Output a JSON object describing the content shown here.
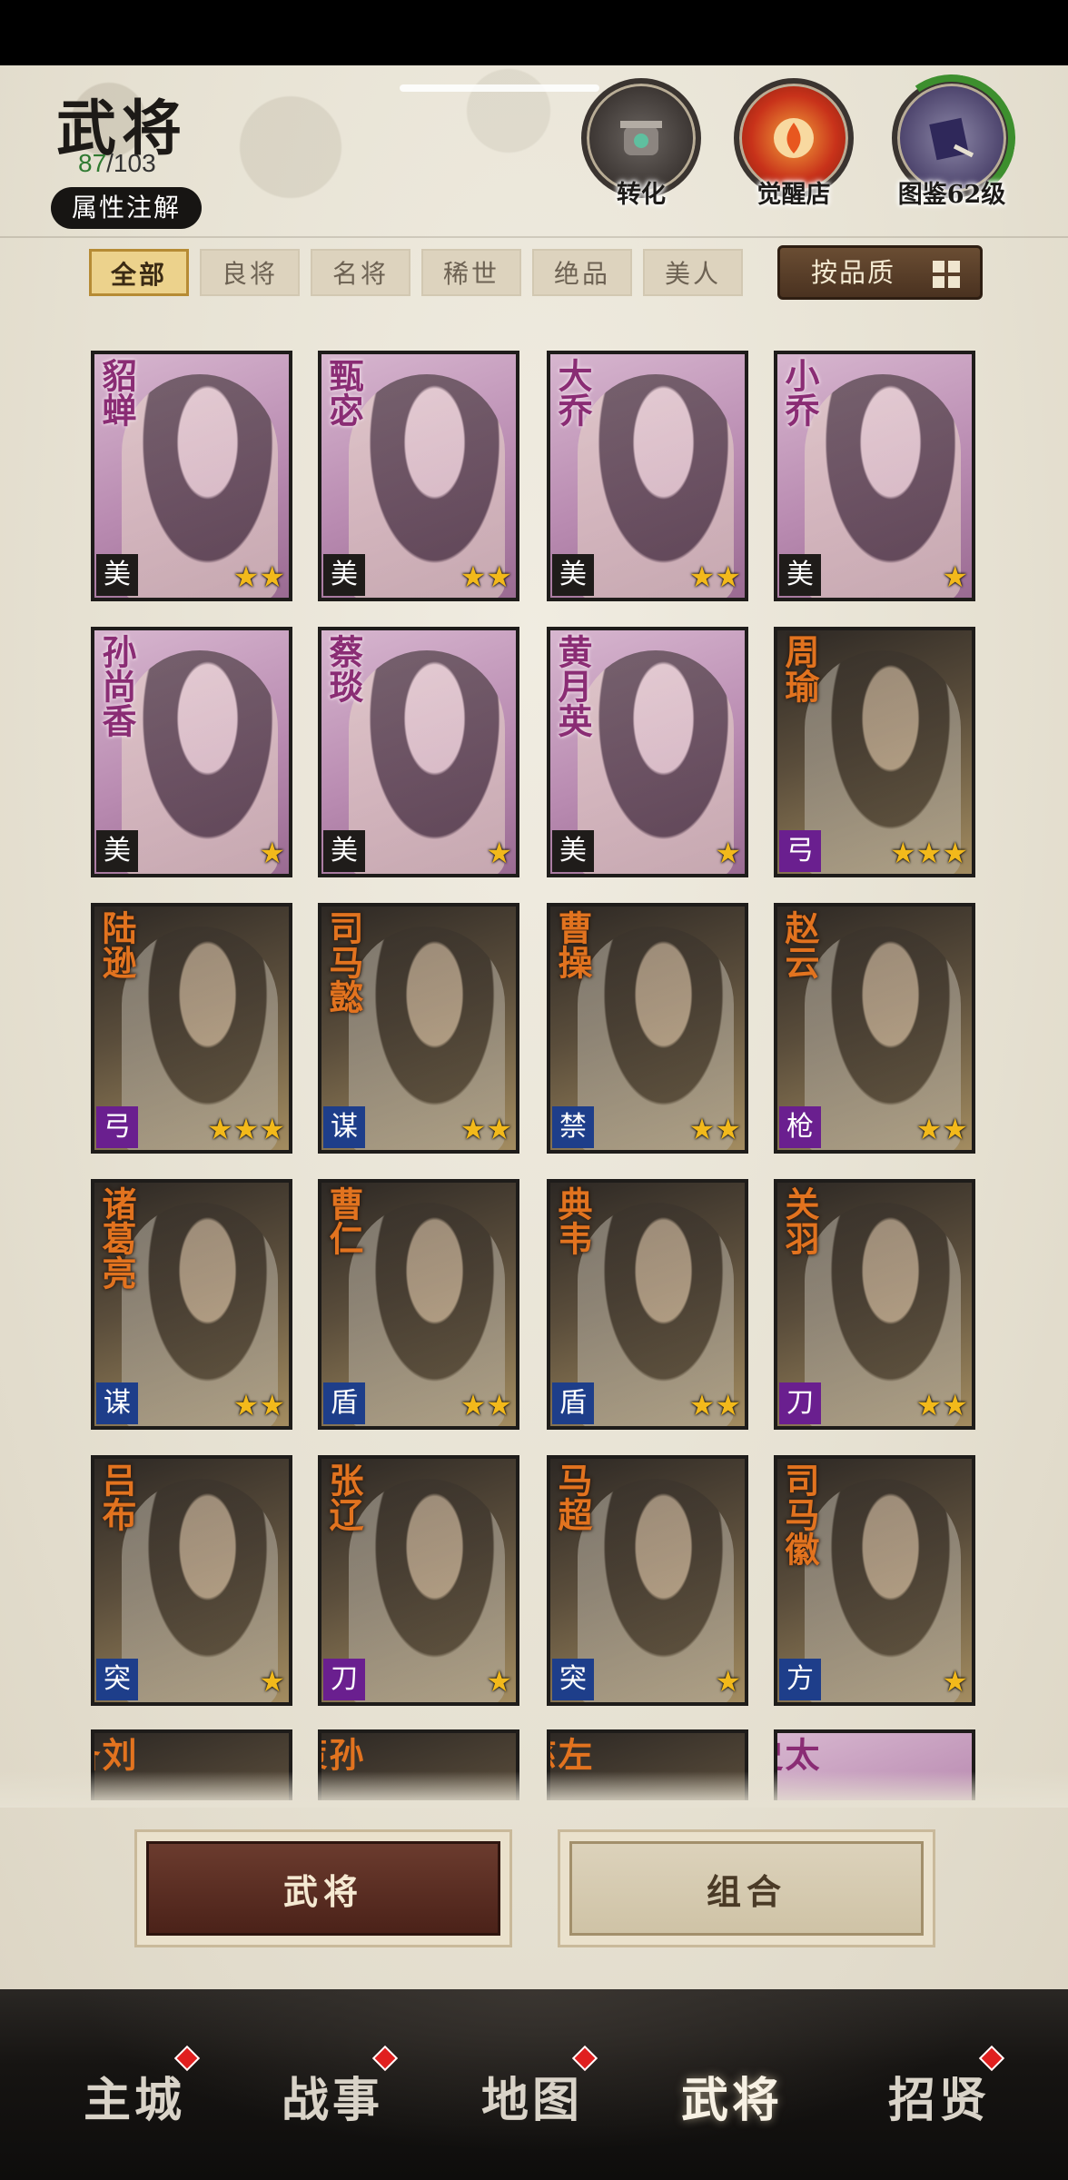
{
  "header": {
    "title": "武将",
    "count_current": "87",
    "count_total": "/103",
    "attr_button": "属性注解"
  },
  "top_icons": [
    {
      "label": "转化",
      "icon": "cauldron-icon"
    },
    {
      "label": "觉醒店",
      "icon": "flame-seal-icon"
    },
    {
      "label": "图鉴62级",
      "icon": "scroll-book-icon"
    }
  ],
  "filters": [
    "全部",
    "良将",
    "名将",
    "稀世",
    "绝品",
    "美人"
  ],
  "active_filter": "全部",
  "sort_button": "按品质",
  "type_colors": {
    "美": "#1f1c1a",
    "弓": "#6a1f8f",
    "谋": "#1e3e8a",
    "禁": "#1e3e8a",
    "枪": "#6a1f8f",
    "盾": "#1e3e8a",
    "刀": "#6a1f8f",
    "突": "#1e3e8a",
    "方": "#1e3e8a"
  },
  "cards": [
    {
      "name": "貂蝉",
      "type": "美",
      "stars": "★★",
      "style": "beauty"
    },
    {
      "name": "甄宓",
      "type": "美",
      "stars": "★★",
      "style": "beauty"
    },
    {
      "name": "大乔",
      "type": "美",
      "stars": "★★",
      "style": "beauty"
    },
    {
      "name": "小乔",
      "type": "美",
      "stars": "★",
      "style": "beauty"
    },
    {
      "name": "孙尚香",
      "type": "美",
      "stars": "★",
      "style": "beauty"
    },
    {
      "name": "蔡琰",
      "type": "美",
      "stars": "★",
      "style": "beauty"
    },
    {
      "name": "黄月英",
      "type": "美",
      "stars": "★",
      "style": "beauty"
    },
    {
      "name": "周瑜",
      "type": "弓",
      "stars": "★★★",
      "style": "hero"
    },
    {
      "name": "陆逊",
      "type": "弓",
      "stars": "★★★",
      "style": "hero"
    },
    {
      "name": "司马懿",
      "type": "谋",
      "stars": "★★",
      "style": "hero"
    },
    {
      "name": "曹操",
      "type": "禁",
      "stars": "★★",
      "style": "hero"
    },
    {
      "name": "赵云",
      "type": "枪",
      "stars": "★★",
      "style": "hero"
    },
    {
      "name": "诸葛亮",
      "type": "谋",
      "stars": "★★",
      "style": "hero"
    },
    {
      "name": "曹仁",
      "type": "盾",
      "stars": "★★",
      "style": "hero"
    },
    {
      "name": "典韦",
      "type": "盾",
      "stars": "★★",
      "style": "hero"
    },
    {
      "name": "关羽",
      "type": "刀",
      "stars": "★★",
      "style": "hero"
    },
    {
      "name": "吕布",
      "type": "突",
      "stars": "★",
      "style": "hero"
    },
    {
      "name": "张辽",
      "type": "刀",
      "stars": "★",
      "style": "hero"
    },
    {
      "name": "马超",
      "type": "突",
      "stars": "★",
      "style": "hero"
    },
    {
      "name": "司马徽",
      "type": "方",
      "stars": "★",
      "style": "hero"
    }
  ],
  "partial_cards": [
    {
      "name": "刘备",
      "style": "hero"
    },
    {
      "name": "孙策",
      "style": "hero"
    },
    {
      "name": "左慈",
      "style": "hero"
    },
    {
      "name": "太史",
      "style": "beauty"
    }
  ],
  "bottom_buttons": {
    "generals": "武将",
    "combos": "组合"
  },
  "nav": [
    {
      "label": "主城",
      "active": false,
      "dot": true
    },
    {
      "label": "战事",
      "active": false,
      "dot": true
    },
    {
      "label": "地图",
      "active": false,
      "dot": true
    },
    {
      "label": "武将",
      "active": true,
      "dot": false
    },
    {
      "label": "招贤",
      "active": false,
      "dot": true
    }
  ]
}
